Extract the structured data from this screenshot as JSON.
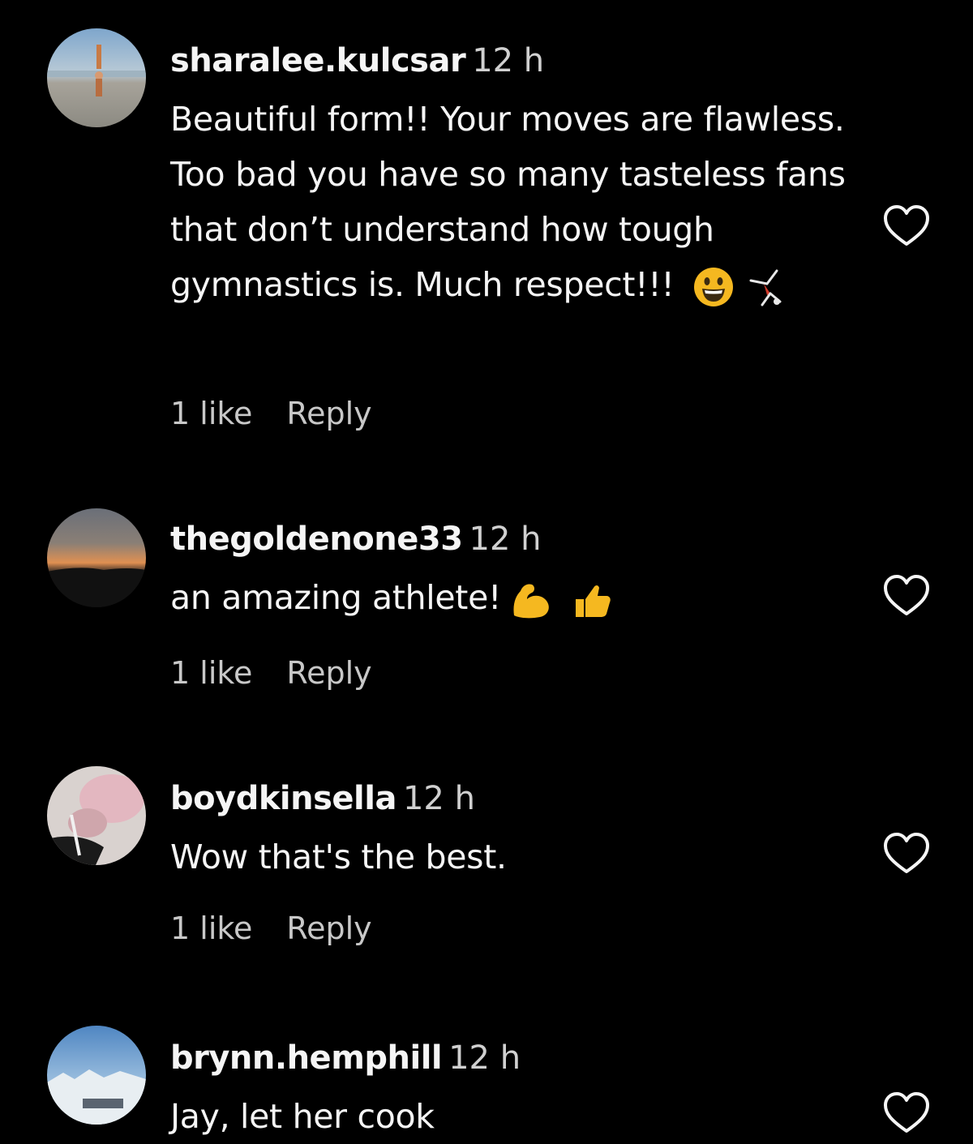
{
  "comments": [
    {
      "username": "sharalee.kulcsar",
      "time": "12 h",
      "text": "Beautiful form!! Your moves are flawless. Too bad you have so many tasteless fans that don’t understand how tough gymnastics is. Much respect!!!",
      "emojis": [
        "grinning-face-emoji",
        "cartwheel-emoji"
      ],
      "likes": "1 like",
      "reply": "Reply"
    },
    {
      "username": "thegoldenone33",
      "time": "12 h",
      "text": "an amazing athlete!",
      "emojis": [
        "flexed-biceps-emoji",
        "thumbs-up-emoji"
      ],
      "likes": "1 like",
      "reply": "Reply"
    },
    {
      "username": "boydkinsella",
      "time": "12 h",
      "text": "Wow that's the best.",
      "emojis": [],
      "likes": "1 like",
      "reply": "Reply"
    },
    {
      "username": "brynn.hemphill",
      "time": "12 h",
      "text": "Jay, let her cook",
      "emojis": [],
      "likes": "",
      "reply": ""
    }
  ],
  "colors": {
    "background": "#000000",
    "text_primary": "#f5f5f5",
    "text_secondary": "#c8c8c8",
    "emoji_yellow": "#f5b820"
  },
  "icons": {
    "like": "heart-outline-icon"
  }
}
